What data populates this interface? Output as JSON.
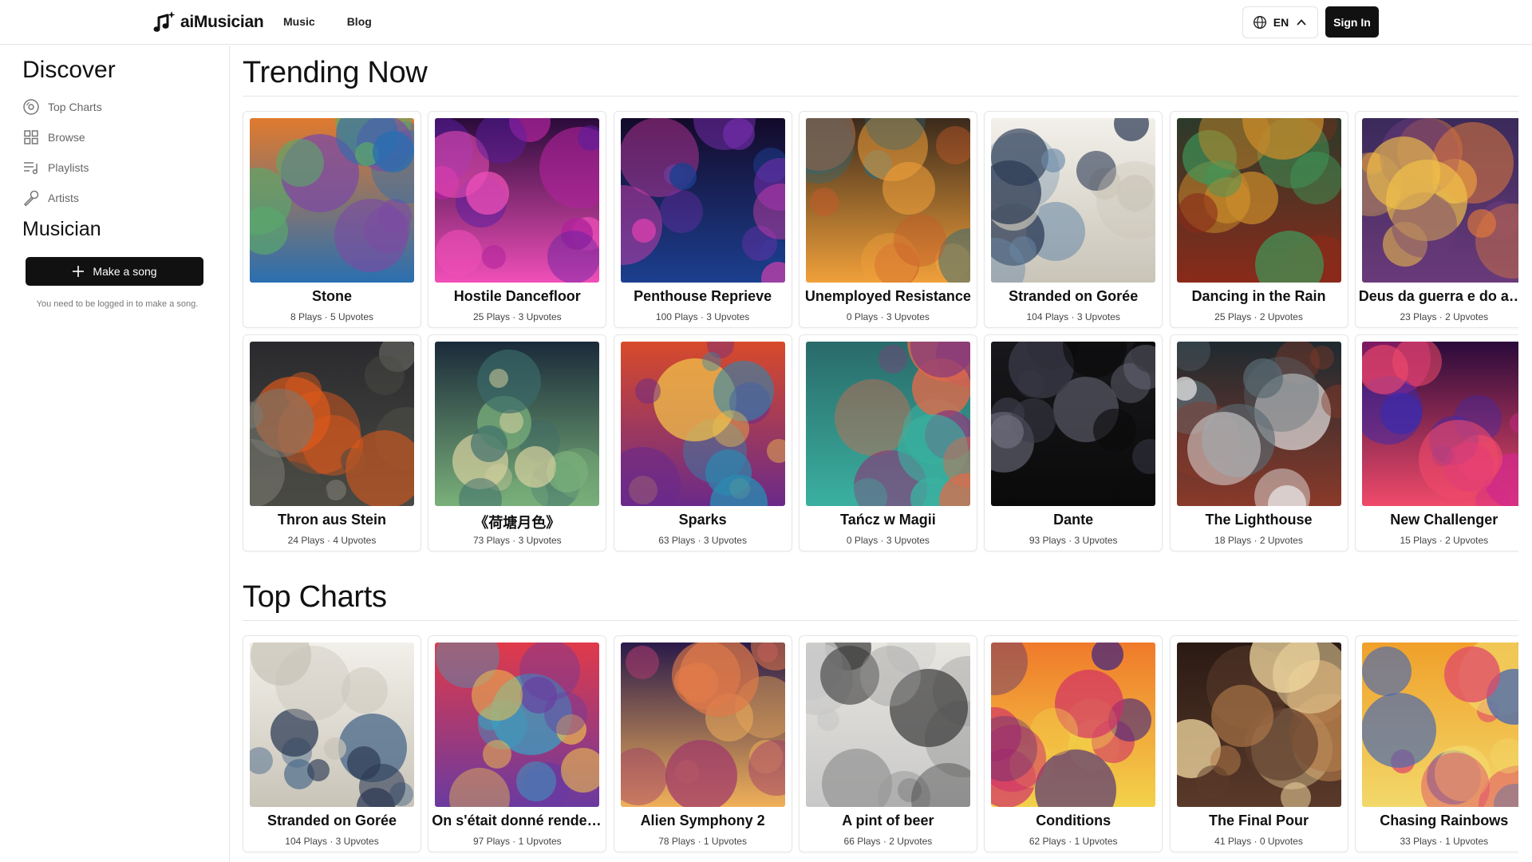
{
  "header": {
    "brand": "aiMusician",
    "nav": [
      "Music",
      "Blog"
    ],
    "language": "EN",
    "sign_in_label": "Sign In"
  },
  "sidebar": {
    "discover_heading": "Discover",
    "items": [
      {
        "label": "Top Charts",
        "icon": "disc-icon"
      },
      {
        "label": "Browse",
        "icon": "grid-icon"
      },
      {
        "label": "Playlists",
        "icon": "playlist-icon"
      },
      {
        "label": "Artists",
        "icon": "microphone-icon"
      }
    ],
    "musician_heading": "Musician",
    "make_song_label": "Make a song",
    "login_note": "You need to be logged in to make a song."
  },
  "trending": {
    "title": "Trending Now",
    "rows": [
      [
        {
          "title": "Stone",
          "meta": "8 Plays · 5 Upvotes"
        },
        {
          "title": "Hostile Dancefloor",
          "meta": "25 Plays · 3 Upvotes"
        },
        {
          "title": "Penthouse Reprieve",
          "meta": "100 Plays · 3 Upvotes"
        },
        {
          "title": "Unemployed Resistance",
          "meta": "0 Plays · 3 Upvotes"
        },
        {
          "title": "Stranded on Gorée",
          "meta": "104 Plays · 3 Upvotes"
        },
        {
          "title": "Dancing in the Rain",
          "meta": "25 Plays · 2 Upvotes"
        },
        {
          "title": "Deus da guerra e do am...",
          "meta": "23 Plays · 2 Upvotes"
        }
      ],
      [
        {
          "title": "Thron aus Stein",
          "meta": "24 Plays · 4 Upvotes"
        },
        {
          "title": "《荷塘月色》",
          "meta": "73 Plays · 3 Upvotes"
        },
        {
          "title": "Sparks",
          "meta": "63 Plays · 3 Upvotes"
        },
        {
          "title": "Tańcz w Magii",
          "meta": "0 Plays · 3 Upvotes"
        },
        {
          "title": "Dante",
          "meta": "93 Plays · 3 Upvotes"
        },
        {
          "title": "The Lighthouse",
          "meta": "18 Plays · 2 Upvotes"
        },
        {
          "title": "New Challenger",
          "meta": "15 Plays · 2 Upvotes"
        }
      ]
    ]
  },
  "top_charts": {
    "title": "Top Charts",
    "rows": [
      [
        {
          "title": "Stranded on Gorée",
          "meta": "104 Plays · 3 Upvotes"
        },
        {
          "title": "On s'était donné rendez...",
          "meta": "97 Plays · 1 Upvotes"
        },
        {
          "title": "Alien Symphony 2",
          "meta": "78 Plays · 1 Upvotes"
        },
        {
          "title": "A pint of beer",
          "meta": "66 Plays · 2 Upvotes"
        },
        {
          "title": "Conditions",
          "meta": "62 Plays · 1 Upvotes"
        },
        {
          "title": "The Final Pour",
          "meta": "41 Plays · 0 Upvotes"
        },
        {
          "title": "Chasing Rainbows",
          "meta": "33 Plays · 1 Upvotes"
        }
      ]
    ]
  }
}
